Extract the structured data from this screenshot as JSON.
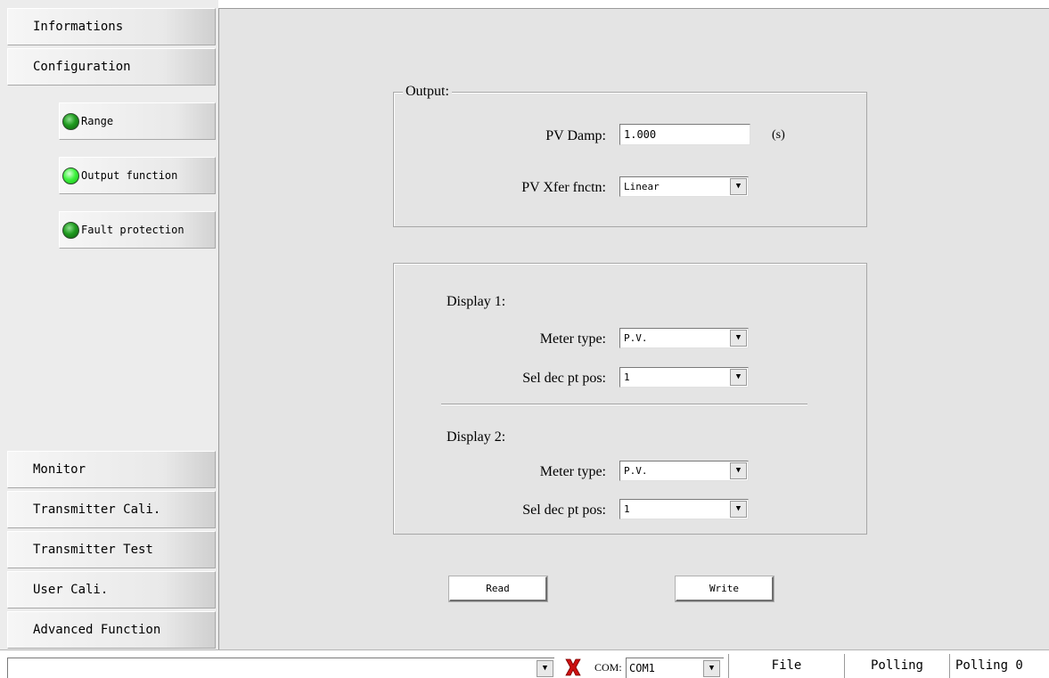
{
  "nav": {
    "top_items": [
      "Informations",
      "Configuration"
    ],
    "sub_items": [
      {
        "label": "Range",
        "status": "active-dark"
      },
      {
        "label": "Output function",
        "status": "active-bright"
      },
      {
        "label": "Fault protection",
        "status": "active-dark"
      }
    ],
    "bottom_items": [
      "Monitor",
      "Transmitter Cali.",
      "Transmitter Test",
      "User Cali.",
      "Advanced Function"
    ]
  },
  "output_group": {
    "legend": "Output:",
    "pv_damp_label": "PV Damp:",
    "pv_damp_value": "1.000",
    "pv_damp_unit": "(s)",
    "pv_xfer_label": "PV Xfer fnctn:",
    "pv_xfer_value": "Linear"
  },
  "display_group": {
    "display1": {
      "title": "Display 1:",
      "meter_type_label": "Meter type:",
      "meter_type_value": "P.V.",
      "dec_pt_label": "Sel dec pt pos:",
      "dec_pt_value": "1"
    },
    "display2": {
      "title": "Display 2:",
      "meter_type_label": "Meter type:",
      "meter_type_value": "P.V.",
      "dec_pt_label": "Sel dec pt pos:",
      "dec_pt_value": "1"
    }
  },
  "buttons": {
    "read": "Read",
    "write": "Write"
  },
  "status_bar": {
    "message": "",
    "connection_icon": "x-disconnected-icon",
    "com_label": "COM:",
    "com_value": "COM1",
    "file": "File",
    "polling": "Polling",
    "polling_count": "Polling 0"
  },
  "colors": {
    "panel_bg": "#e4e4e4",
    "led_green": "#2fd62f",
    "error_red": "#cc1010"
  }
}
